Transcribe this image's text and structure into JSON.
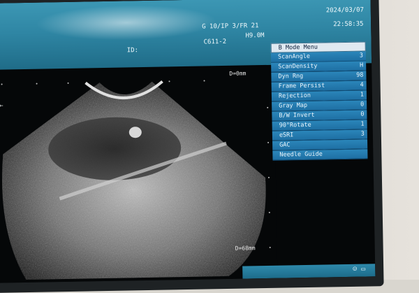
{
  "header": {
    "date": "2024/03/07",
    "time": "22:58:35",
    "params": "G 10/IP 3/FR 21",
    "id_label": "ID:",
    "probe": "C611-2",
    "mode": "H9.0M"
  },
  "scan": {
    "depth_top": "D=0mm",
    "depth_bottom": "D=68mm"
  },
  "menu": {
    "title": "B Mode Menu",
    "items": [
      {
        "label": "ScanAngle",
        "value": "3"
      },
      {
        "label": "ScanDensity",
        "value": "H"
      },
      {
        "label": "Dyn Rng",
        "value": "98"
      },
      {
        "label": "Frame Persist",
        "value": "4"
      },
      {
        "label": "Rejection",
        "value": "1"
      },
      {
        "label": "Gray Map",
        "value": "0"
      },
      {
        "label": "B/W Invert",
        "value": "0"
      },
      {
        "label": "90°Rotate",
        "value": "1"
      },
      {
        "label": "eSRI",
        "value": "3"
      },
      {
        "label": "GAC",
        "value": ""
      },
      {
        "label": "Needle Guide",
        "value": ""
      }
    ]
  },
  "left_marker": "←",
  "bottom_icons": "☺ ▭",
  "colors": {
    "header_blue": "#2f86a4",
    "menu_blue": "#1e6fa3",
    "menu_title_bg": "#dfe9f1"
  }
}
